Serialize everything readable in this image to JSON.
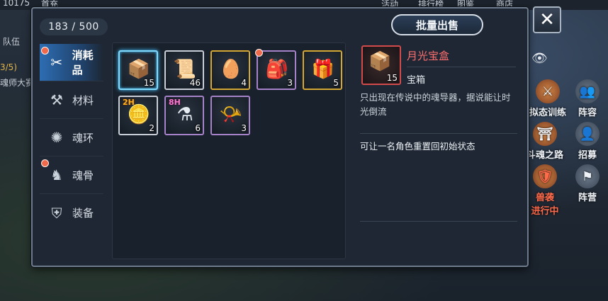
{
  "background": {
    "top_labels": [
      "10175",
      "首充",
      "活动",
      "排行榜",
      "图鉴",
      "商店"
    ],
    "left_labels": [
      "队伍",
      "3/5)",
      "魂师大赛"
    ],
    "side_buttons": [
      {
        "label": "拟态训练",
        "icon": "training-icon"
      },
      {
        "label": "阵容",
        "icon": "lineup-icon"
      },
      {
        "label": "斗魂之路",
        "icon": "path-icon"
      },
      {
        "label": "招募",
        "icon": "recruit-icon"
      },
      {
        "label": "兽袭",
        "sub": "进行中",
        "icon": "beast-icon"
      },
      {
        "label": "阵营",
        "icon": "camp-icon"
      }
    ]
  },
  "inventory": {
    "capacity": "183 / 500",
    "sell_button": "批量出售",
    "close_label": "✕"
  },
  "tabs": [
    {
      "label": "消耗品",
      "icon": "consumable-icon",
      "active": true,
      "dot": true
    },
    {
      "label": "材料",
      "icon": "anvil-icon",
      "active": false,
      "dot": false
    },
    {
      "label": "魂环",
      "icon": "soul-ring-icon",
      "active": false,
      "dot": false
    },
    {
      "label": "魂骨",
      "icon": "soul-bone-icon",
      "active": false,
      "dot": true
    },
    {
      "label": "装备",
      "icon": "equipment-icon",
      "active": false,
      "dot": false
    }
  ],
  "items": [
    {
      "name": "月光宝盒",
      "icon": "treasure-box-icon",
      "glyph": "📦",
      "qty": "15",
      "rarity": "selected",
      "dot": false
    },
    {
      "name": "scroll",
      "icon": "scroll-icon",
      "glyph": "📜",
      "qty": "46",
      "rarity": "white",
      "dot": false
    },
    {
      "name": "egg",
      "icon": "egg-icon",
      "glyph": "🥚",
      "qty": "4",
      "rarity": "gold",
      "dot": false
    },
    {
      "name": "bag",
      "icon": "bag-icon",
      "glyph": "🎒",
      "qty": "3",
      "rarity": "purple",
      "dot": true
    },
    {
      "name": "gift",
      "icon": "gift-icon",
      "glyph": "🎁",
      "qty": "5",
      "rarity": "gold",
      "dot": false
    },
    {
      "name": "coins",
      "icon": "coins-icon",
      "glyph": "🪙",
      "qty": "2",
      "rarity": "white",
      "dot": false,
      "tag": "2H"
    },
    {
      "name": "potion",
      "icon": "potion-icon",
      "glyph": "⚗",
      "qty": "6",
      "rarity": "purple",
      "dot": false,
      "tag": "8H"
    },
    {
      "name": "horn",
      "icon": "horn-icon",
      "glyph": "📯",
      "qty": "3",
      "rarity": "purple",
      "dot": false
    }
  ],
  "detail": {
    "name": "月光宝盒",
    "qty": "15",
    "type": "宝箱",
    "description": "只出现在传说中的魂导器，据说能让时光倒流",
    "effect": "可让一名角色重置回初始状态",
    "name_color": "#ff6f6f"
  }
}
